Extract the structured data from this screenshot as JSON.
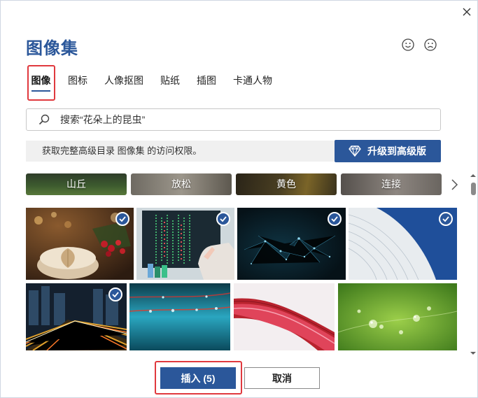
{
  "dialog": {
    "title": "图像集",
    "close_icon": "close-icon",
    "feedback": {
      "happy_icon": "smile-icon",
      "sad_icon": "frown-icon"
    }
  },
  "tabs": [
    {
      "label": "图像",
      "active": true
    },
    {
      "label": "图标",
      "active": false
    },
    {
      "label": "人像抠图",
      "active": false
    },
    {
      "label": "贴纸",
      "active": false
    },
    {
      "label": "插图",
      "active": false
    },
    {
      "label": "卡通人物",
      "active": false
    }
  ],
  "search": {
    "placeholder": "搜索“花朵上的昆虫”",
    "icon": "search-icon"
  },
  "promo": {
    "text": "获取完整高级目录 图像集 的访问权限。",
    "upgrade_label": "升级到高级版",
    "upgrade_icon": "diamond-icon"
  },
  "categories": [
    {
      "label": "山丘"
    },
    {
      "label": "放松"
    },
    {
      "label": "黄色"
    },
    {
      "label": "连接"
    }
  ],
  "images": [
    {
      "subject": "coffee-leaf-berries",
      "selected": true
    },
    {
      "subject": "lab-data-screen",
      "selected": true
    },
    {
      "subject": "network-plexus",
      "selected": true
    },
    {
      "subject": "white-architecture-curve",
      "selected": true
    },
    {
      "subject": "city-light-trails",
      "selected": true
    },
    {
      "subject": "water-droplets-wire",
      "selected": false
    },
    {
      "subject": "red-wave-abstract",
      "selected": false
    },
    {
      "subject": "green-dew-leaf",
      "selected": false
    }
  ],
  "footer": {
    "insert_label": "插入 (5)",
    "cancel_label": "取消"
  },
  "colors": {
    "accent": "#2b579a",
    "highlight": "#e0393e"
  }
}
